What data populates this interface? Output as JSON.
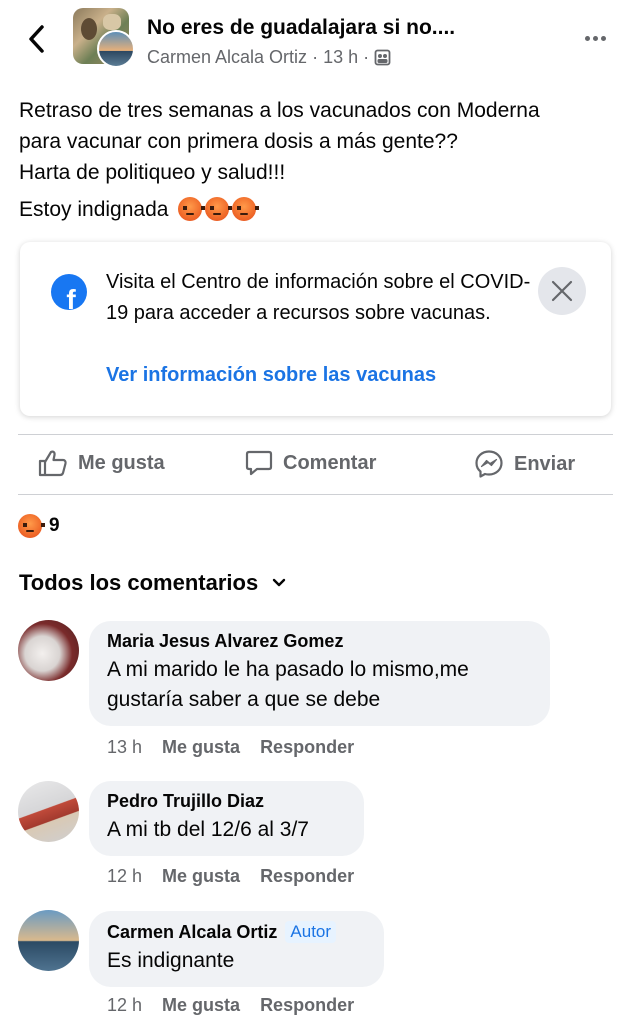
{
  "header": {
    "group_title": "No eres de guadalajara si no....",
    "author": "Carmen Alcala Ortiz",
    "separator": "·",
    "time": "13 h"
  },
  "post": {
    "lines": [
      "Retraso de tres semanas a los vacunados con Moderna",
      "para vacunar con primera dosis a más gente??",
      "Harta de politiqueo y salud!!!"
    ],
    "last_line": "Estoy indignada",
    "emojis": [
      "angry-emoji",
      "angry-emoji",
      "angry-emoji"
    ]
  },
  "covid_card": {
    "text": "Visita el Centro de información sobre el COVID-19 para acceder a recursos sobre vacunas.",
    "link": "Ver información sobre las vacunas"
  },
  "actions": {
    "like": "Me gusta",
    "comment": "Comentar",
    "send": "Enviar"
  },
  "reactions": {
    "count": "9",
    "icon": "angry-reaction-icon"
  },
  "comments_header": {
    "label": "Todos los comentarios"
  },
  "comments": [
    {
      "name": "Maria Jesus Alvarez Gomez",
      "text": "A mi marido le ha pasado lo mismo,me gustaría saber a que se debe",
      "time": "13 h",
      "like": "Me gusta",
      "reply": "Responder"
    },
    {
      "name": "Pedro Trujillo Diaz",
      "text": "A mi tb del 12/6 al 3/7",
      "time": "12 h",
      "like": "Me gusta",
      "reply": "Responder"
    },
    {
      "name": "Carmen Alcala Ortiz",
      "badge": "Autor",
      "text": "Es indignante",
      "time": "12 h",
      "like": "Me gusta",
      "reply": "Responder"
    }
  ],
  "colors": {
    "accent": "#1b74e4",
    "secondary_text": "#65676b",
    "bubble": "#f0f2f5"
  }
}
